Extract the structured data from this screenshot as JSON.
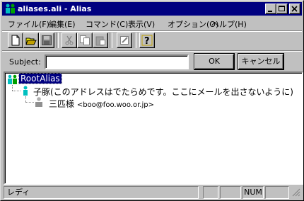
{
  "window": {
    "title": "aliases.ali - Alias"
  },
  "menu": {
    "items": [
      "ファイル(F)",
      "編集(E)",
      "コマンド(C)",
      "表示(V)",
      "オプション(O)",
      "ヘルプ(H)"
    ]
  },
  "toolbar": {
    "buttons": [
      "new-icon",
      "open-icon",
      "save-icon",
      "cut-icon",
      "copy-icon",
      "paste-icon",
      "edit-icon",
      "help-icon"
    ]
  },
  "subject": {
    "label": "Subject:",
    "value": ""
  },
  "buttons": {
    "ok": "OK",
    "cancel": "キャンセル"
  },
  "tree": {
    "root": "RootAlias",
    "child": "子豚(このアドレスはでたらめです。ここにメールを出さないように)",
    "leaf_name": "三匹様",
    "leaf_email": "<boo@foo.woo.or.jp>"
  },
  "status": {
    "text": "レディ",
    "num": "NUM"
  },
  "colors": {
    "titlebar": "#000080",
    "selection": "#000080",
    "face": "#c0c0c0"
  }
}
